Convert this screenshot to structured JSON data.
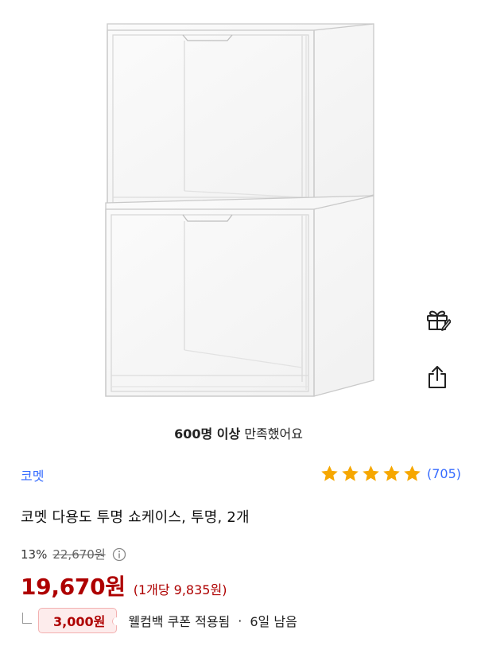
{
  "product_image": {
    "alt": "clear stacked showcase boxes",
    "icon": "product-photo"
  },
  "side_actions": {
    "gift_icon": "gift-icon",
    "share_icon": "share-icon"
  },
  "satisfaction": {
    "bold": "600명 이상",
    "rest": "만족했어요"
  },
  "brand": {
    "name": "코멧"
  },
  "rating": {
    "stars": 5,
    "count_label": "(705)",
    "star_color": "#f6a700"
  },
  "title": "코멧 다용도 투명 쇼케이스, 투명, 2개",
  "price": {
    "discount_rate": "13%",
    "original": "22,670원",
    "sale": "19,670원",
    "unit": "(1개당 9,835원)",
    "accent_color": "#ae0000"
  },
  "coupon": {
    "amount": "3,000원",
    "text": "웰컴백 쿠폰 적용됨",
    "separator": "·",
    "expire": "6일 남음"
  },
  "colors": {
    "link": "#346aff"
  }
}
